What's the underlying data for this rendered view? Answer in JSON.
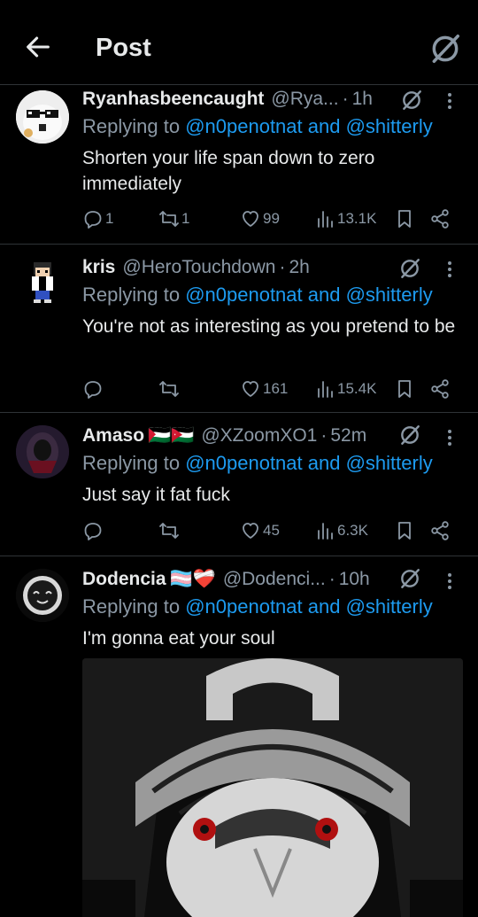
{
  "header": {
    "title": "Post",
    "back_icon": "arrow-left-icon",
    "grok_icon": "grok-icon"
  },
  "tweets": [
    {
      "name": "Ryanhasbeencaught",
      "handle": "@Rya...",
      "sep": "·",
      "time": "1h",
      "replying_prefix": "Replying to",
      "replying_to": "@n0penotnat and @shitterly",
      "text": "Shorten your life span down to zero immediately",
      "replies": "1",
      "reposts": "1",
      "likes": "99",
      "views": "13.1K"
    },
    {
      "name": "kris",
      "handle": "@HeroTouchdown",
      "sep": "·",
      "time": "2h",
      "replying_prefix": "Replying to",
      "replying_to": "@n0penotnat and @shitterly",
      "text": "You're not as interesting as you pretend to be",
      "replies": "",
      "reposts": "",
      "likes": "161",
      "views": "15.4K"
    },
    {
      "name": "Amaso",
      "flags": "🇵🇸🇯🇴",
      "handle": "@XZoomXO1",
      "sep": "·",
      "time": "52m",
      "replying_prefix": "Replying to",
      "replying_to": "@n0penotnat and @shitterly",
      "text": "Just say it fat fuck",
      "replies": "",
      "reposts": "",
      "likes": "45",
      "views": "6.3K"
    },
    {
      "name": "Dodencia",
      "flags": "🏳️‍⚧️❤️‍🩹",
      "handle": "@Dodenci...",
      "sep": "·",
      "time": "10h",
      "replying_prefix": "Replying to",
      "replying_to": "@n0penotnat and @shitterly",
      "text": "I'm gonna eat your soul"
    }
  ],
  "colors": {
    "link": "#1d9bf0",
    "muted": "#8b98a5",
    "text": "#e7e9ea",
    "divider": "#2f3336"
  }
}
